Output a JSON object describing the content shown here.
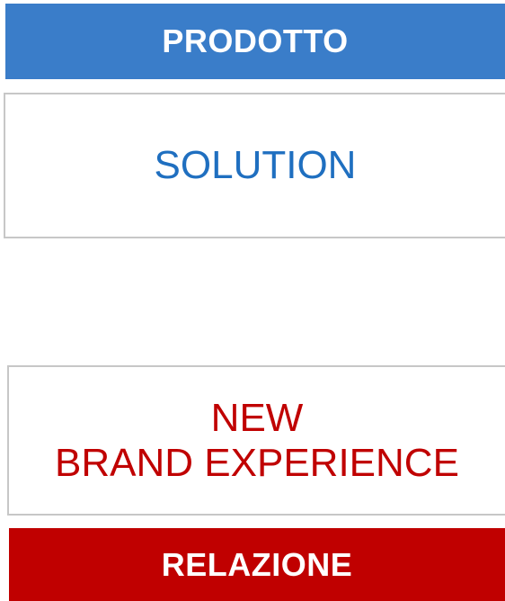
{
  "top_bar": {
    "label": "PRODOTTO",
    "color": "#3a7dc9"
  },
  "top_box": {
    "text": "SOLUTION",
    "color": "#1f6fc0"
  },
  "bottom_box": {
    "line1": "NEW",
    "line2": "BRAND EXPERIENCE",
    "color": "#c00000"
  },
  "bottom_bar": {
    "label": "RELAZIONE",
    "color": "#c00000"
  }
}
